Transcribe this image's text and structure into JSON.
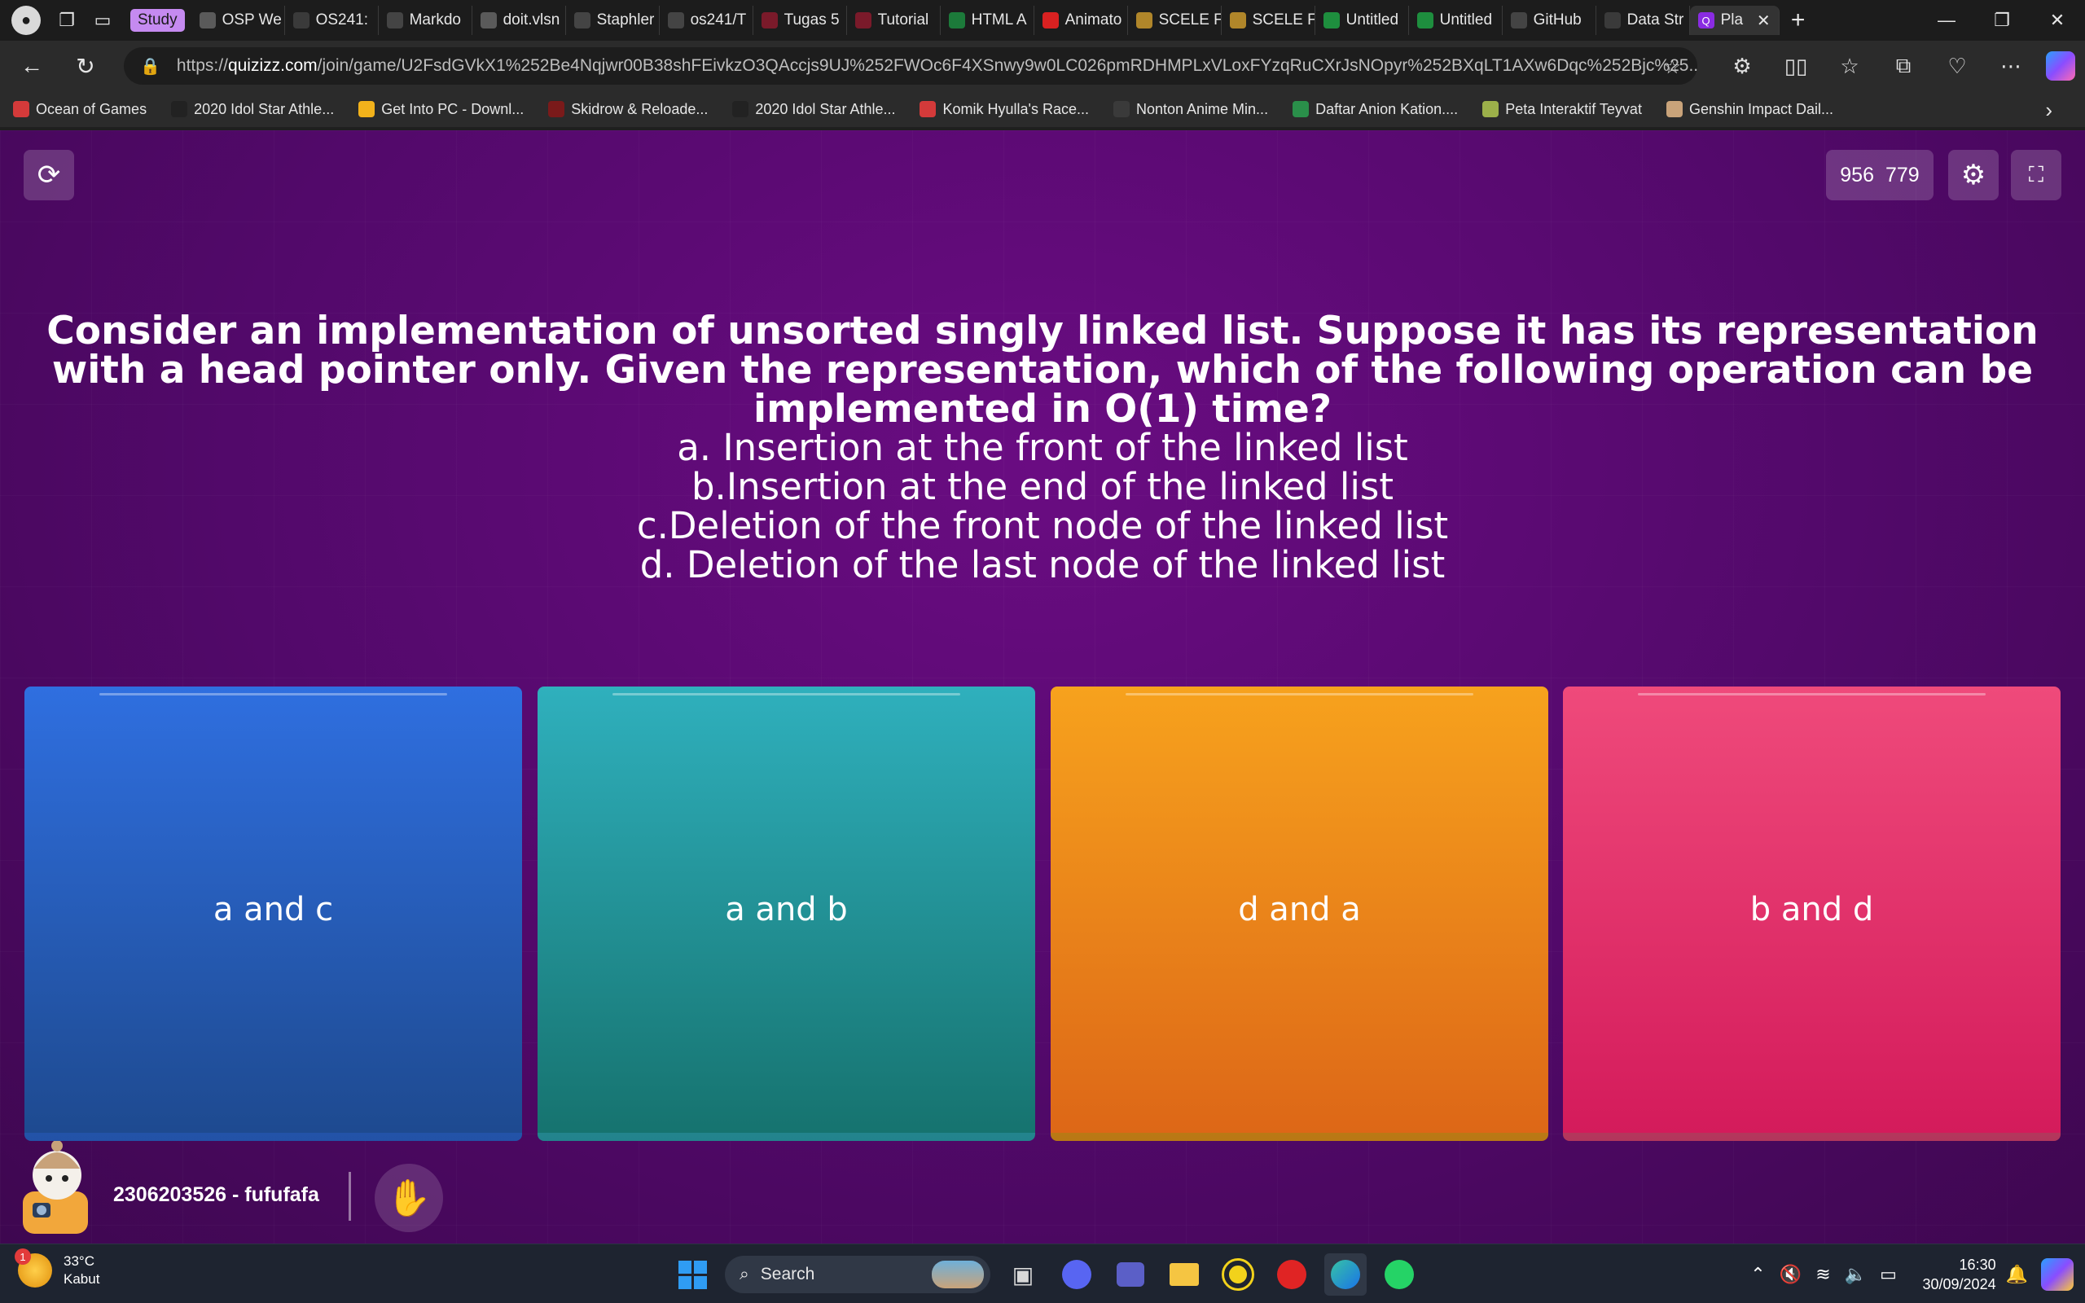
{
  "browser": {
    "tab_group": "Study",
    "tabs": [
      {
        "label": "OSP We",
        "icon": "image-icon",
        "color": "#5a5a5a"
      },
      {
        "label": "OS241:",
        "icon": "page-icon",
        "color": "#3a3a3a"
      },
      {
        "label": "Markdo",
        "icon": "github-icon",
        "color": "#444444"
      },
      {
        "label": "doit.vlsn",
        "icon": "image-icon",
        "color": "#5a5a5a"
      },
      {
        "label": "Staphler",
        "icon": "github-icon",
        "color": "#444444"
      },
      {
        "label": "os241/T",
        "icon": "github-icon",
        "color": "#444444"
      },
      {
        "label": "Tugas 5",
        "icon": "video-icon",
        "color": "#7a1a2a"
      },
      {
        "label": "Tutorial",
        "icon": "video-icon",
        "color": "#7a1a2a"
      },
      {
        "label": "HTML A",
        "icon": "w3-icon",
        "color": "#1c7a3a"
      },
      {
        "label": "Animato",
        "icon": "youtube-icon",
        "color": "#d92121"
      },
      {
        "label": "SCELE F",
        "icon": "scele-icon",
        "color": "#b0862a"
      },
      {
        "label": "SCELE F",
        "icon": "scele-icon",
        "color": "#b0862a"
      },
      {
        "label": "Untitled",
        "icon": "sheets-icon",
        "color": "#1e8e3e"
      },
      {
        "label": "Untitled",
        "icon": "sheets-icon",
        "color": "#1e8e3e"
      },
      {
        "label": "GitHub",
        "icon": "openai-icon",
        "color": "#444444"
      },
      {
        "label": "Data Str",
        "icon": "page-icon",
        "color": "#3a3a3a"
      }
    ],
    "active_tab": {
      "label": "Pla",
      "icon": "quizizz-icon",
      "color": "#8a2be2"
    },
    "url_host": "quizizz.com",
    "url_prefix": "https://",
    "url_path": "/join/game/U2FsdGVkX1%252Be4Nqjwr00B38shFEivkzO3QAccjs9UJ%252FWOc6F4XSnwy9w0LC026pmRDHMPLxVLoxFYzqRuCXrJsNOpyr%252BXqLT1AXw6Dqc%252Bjc%25...",
    "bookmarks": [
      {
        "label": "Ocean of Games",
        "icon": "car-icon",
        "color": "#d43a3a"
      },
      {
        "label": "2020 Idol Star Athle...",
        "icon": "circle-logo-icon",
        "color": "#222222"
      },
      {
        "label": "Get Into PC - Downl...",
        "icon": "g-logo-icon",
        "color": "#f2b21b"
      },
      {
        "label": "Skidrow & Reloade...",
        "icon": "skull-icon",
        "color": "#7a1a1a"
      },
      {
        "label": "2020 Idol Star Athle...",
        "icon": "circle-logo-icon",
        "color": "#222222"
      },
      {
        "label": "Komik Hyulla's Race...",
        "icon": "flag-icon",
        "color": "#d43a3a"
      },
      {
        "label": "Nonton Anime Min...",
        "icon": "page-icon",
        "color": "#3a3a3a"
      },
      {
        "label": "Daftar Anion Kation....",
        "icon": "drive-icon",
        "color": "#2a8f4a"
      },
      {
        "label": "Peta Interaktif Teyvat",
        "icon": "map-icon",
        "color": "#9cb04a"
      },
      {
        "label": "Genshin Impact Dail...",
        "icon": "game-icon",
        "color": "#c9a37a"
      }
    ]
  },
  "quiz": {
    "resolution": {
      "w": "956",
      "h": "779"
    },
    "question": "Consider an implementation of unsorted singly linked list. Suppose it has its representation with a head pointer only. Given the representation, which of the following operation can be implemented in O(1) time?",
    "options": [
      "a. Insertion at the front of the linked list",
      "b.Insertion at the end of the linked list",
      "c.Deletion of the front node of the linked list",
      "d. Deletion of the last node of the linked list"
    ],
    "answers": [
      "a and c",
      "a and b",
      "d and a",
      "b and d"
    ],
    "answer_colors": [
      "#2f6fe0",
      "#2fb0bd",
      "#f7a21d",
      "#ef4a7b"
    ],
    "player_name": "2306203526 - fufufafa"
  },
  "taskbar": {
    "weather_temp": "33°C",
    "weather_desc": "Kabut",
    "weather_badge": "1",
    "search_placeholder": "Search",
    "time": "16:30",
    "date": "30/09/2024",
    "pinned": [
      "file-explorer-icon",
      "discord-icon",
      "teams-icon",
      "folder-icon",
      "app-icon",
      "terminal-icon",
      "edge-icon",
      "whatsapp-icon"
    ]
  }
}
